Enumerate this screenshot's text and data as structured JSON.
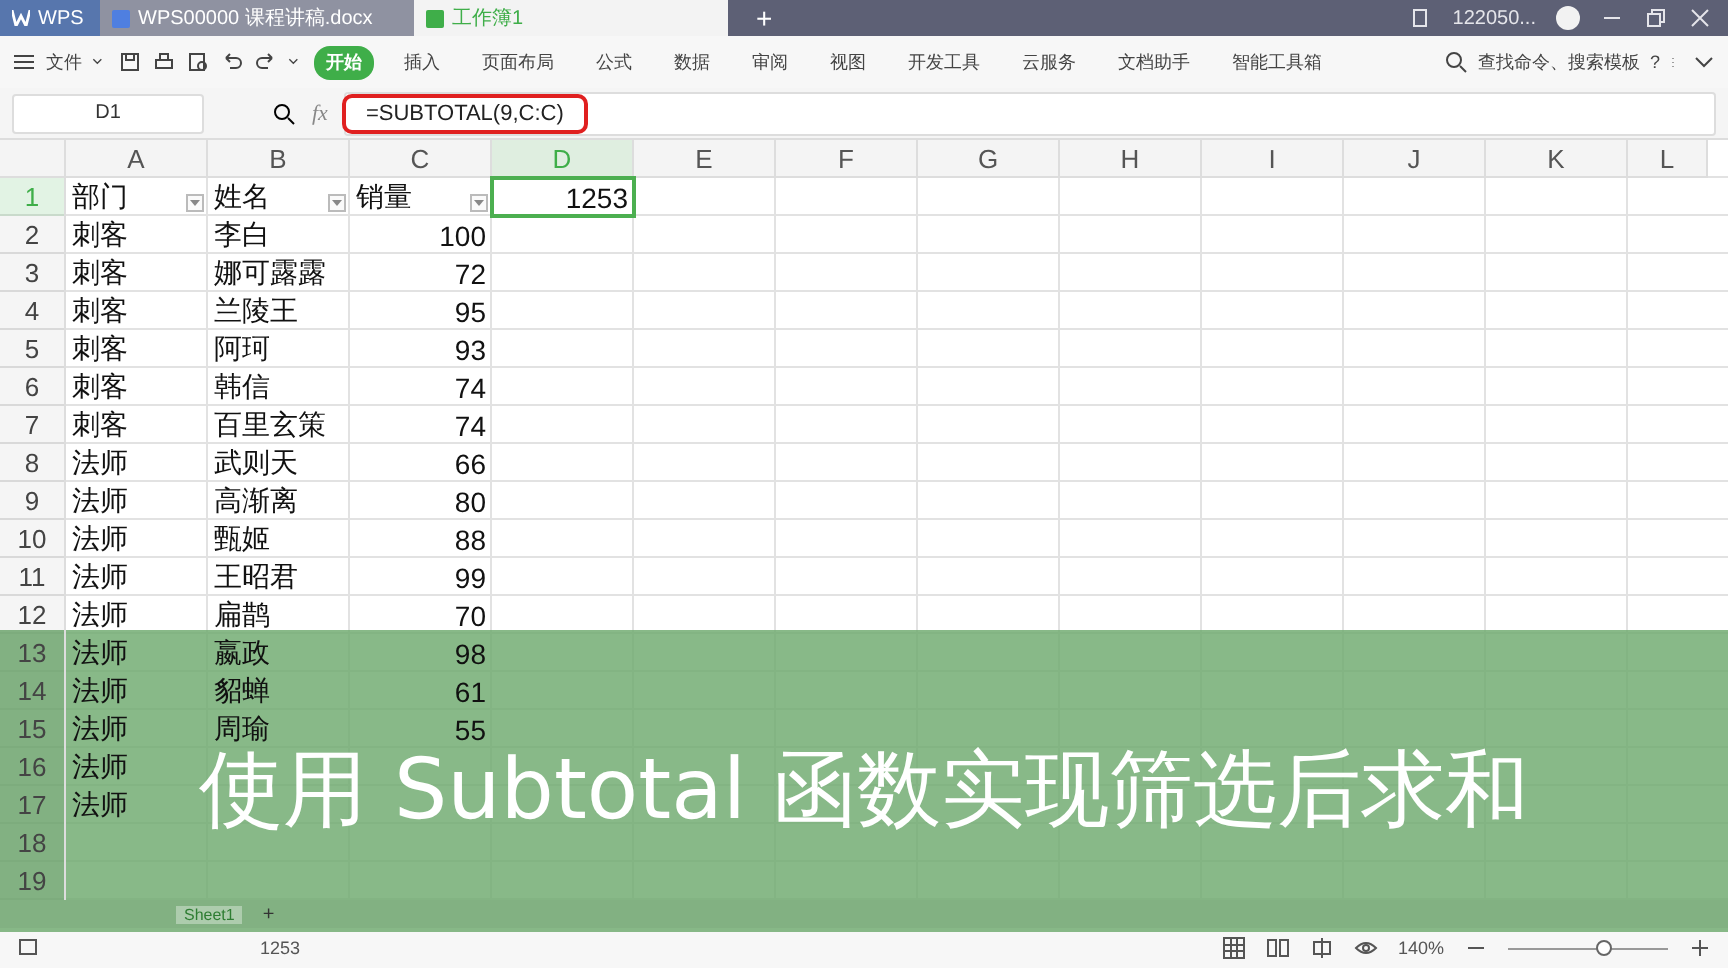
{
  "app_tabs": [
    {
      "label": "WPS",
      "kind": "home",
      "selected": false
    },
    {
      "label": "WPS00000 课程讲稿.docx",
      "kind": "doc",
      "selected": false
    },
    {
      "label": "工作簿1",
      "kind": "sheet",
      "selected": true
    }
  ],
  "new_tab": "+",
  "account": "122050...",
  "menu": {
    "file": "文件",
    "tabs": [
      {
        "label": "开始",
        "selected": true
      },
      {
        "label": "插入",
        "selected": false
      },
      {
        "label": "页面布局",
        "selected": false
      },
      {
        "label": "公式",
        "selected": false
      },
      {
        "label": "数据",
        "selected": false
      },
      {
        "label": "审阅",
        "selected": false
      },
      {
        "label": "视图",
        "selected": false
      },
      {
        "label": "开发工具",
        "selected": false
      },
      {
        "label": "云服务",
        "selected": false
      },
      {
        "label": "文档助手",
        "selected": false
      },
      {
        "label": "智能工具箱",
        "selected": false
      }
    ],
    "search": "查找命令、搜索模板",
    "help": "?"
  },
  "formula_bar": {
    "name_box": "D1",
    "fx": "fx",
    "formula": "=SUBTOTAL(9,C:C)"
  },
  "columns": [
    {
      "label": "A",
      "selected": false
    },
    {
      "label": "B",
      "selected": false
    },
    {
      "label": "C",
      "selected": false
    },
    {
      "label": "D",
      "selected": true
    },
    {
      "label": "E",
      "selected": false
    },
    {
      "label": "F",
      "selected": false
    },
    {
      "label": "G",
      "selected": false
    },
    {
      "label": "H",
      "selected": false
    },
    {
      "label": "I",
      "selected": false
    },
    {
      "label": "J",
      "selected": false
    },
    {
      "label": "K",
      "selected": false
    },
    {
      "label": "L",
      "selected": false
    }
  ],
  "autofilter": true,
  "rows": [
    {
      "number": "1",
      "selected": true,
      "cells": [
        "部门",
        "姓名",
        "销量",
        "1253"
      ]
    },
    {
      "number": "2",
      "selected": false,
      "cells": [
        "刺客",
        "李白",
        "100"
      ]
    },
    {
      "number": "3",
      "selected": false,
      "cells": [
        "刺客",
        "娜可露露",
        "72"
      ]
    },
    {
      "number": "4",
      "selected": false,
      "cells": [
        "刺客",
        "兰陵王",
        "95"
      ]
    },
    {
      "number": "5",
      "selected": false,
      "cells": [
        "刺客",
        "阿珂",
        "93"
      ]
    },
    {
      "number": "6",
      "selected": false,
      "cells": [
        "刺客",
        "韩信",
        "74"
      ]
    },
    {
      "number": "7",
      "selected": false,
      "cells": [
        "刺客",
        "百里玄策",
        "74"
      ]
    },
    {
      "number": "8",
      "selected": false,
      "cells": [
        "法师",
        "武则天",
        "66"
      ]
    },
    {
      "number": "9",
      "selected": false,
      "cells": [
        "法师",
        "高渐离",
        "80"
      ]
    },
    {
      "number": "10",
      "selected": false,
      "cells": [
        "法师",
        "甄姬",
        "88"
      ]
    },
    {
      "number": "11",
      "selected": false,
      "cells": [
        "法师",
        "王昭君",
        "99"
      ]
    },
    {
      "number": "12",
      "selected": false,
      "cells": [
        "法师",
        "扁鹊",
        "70"
      ]
    },
    {
      "number": "13",
      "selected": false,
      "cells": [
        "法师",
        "嬴政",
        "98"
      ]
    },
    {
      "number": "14",
      "selected": false,
      "cells": [
        "法师",
        "貂蝉",
        "61"
      ]
    },
    {
      "number": "15",
      "selected": false,
      "cells": [
        "法师",
        "周瑜",
        "55"
      ]
    },
    {
      "number": "16",
      "selected": false,
      "cells": [
        "法师"
      ]
    },
    {
      "number": "17",
      "selected": false,
      "cells": [
        "法师"
      ]
    },
    {
      "number": "18",
      "selected": false,
      "cells": []
    },
    {
      "number": "19",
      "selected": false,
      "cells": []
    }
  ],
  "sheet_tabs": [
    {
      "label": "Sheet1",
      "selected": true
    }
  ],
  "add_sheet": "+",
  "status_bar": {
    "value": "1253",
    "zoom": "140%",
    "zoom_slider": {
      "level": 0.6
    }
  },
  "banner": "使用 Subtotal 函数实现筛选后求和"
}
